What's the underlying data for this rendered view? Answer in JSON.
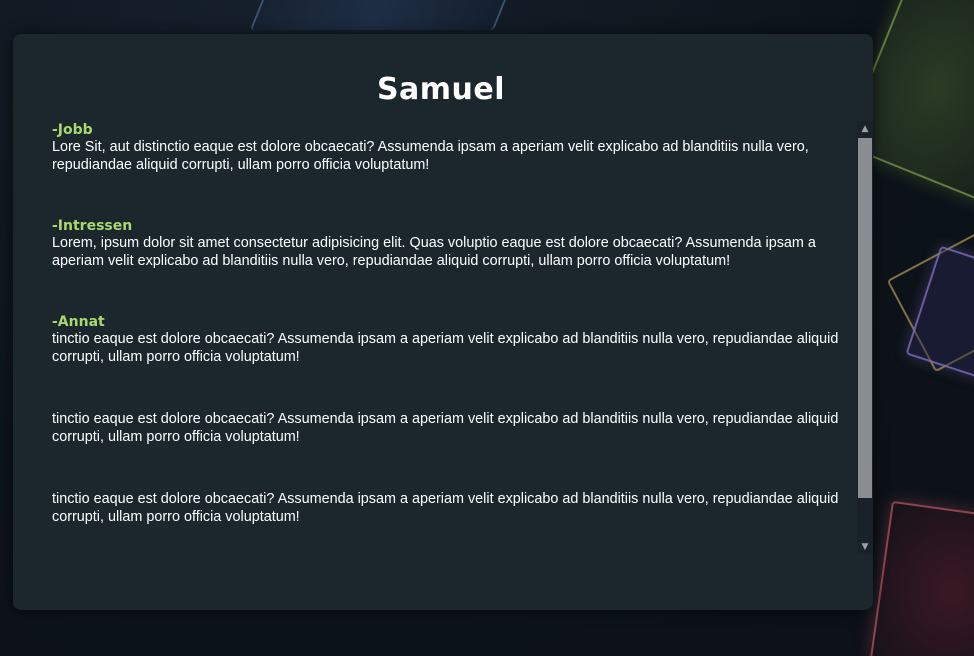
{
  "profile": {
    "name": "Samuel"
  },
  "sections": [
    {
      "heading": "-Jobb",
      "text": "Lore Sit, aut distinctio eaque est dolore obcaecati? Assumenda ipsam a aperiam velit explicabo ad blanditiis nulla vero, repudiandae aliquid corrupti, ullam porro officia voluptatum!"
    },
    {
      "heading": "-Intressen",
      "text": "Lorem, ipsum dolor sit amet consectetur adipisicing elit. Quas voluptio eaque est dolore obcaecati? Assumenda ipsam a aperiam velit explicabo ad blanditiis nulla vero, repudiandae aliquid corrupti, ullam porro officia voluptatum!"
    },
    {
      "heading": "-Annat",
      "text": "tinctio eaque est dolore obcaecati? Assumenda ipsam a aperiam velit explicabo ad blanditiis nulla vero, repudiandae aliquid corrupti, ullam porro officia voluptatum!"
    }
  ],
  "extra_paragraphs": [
    "tinctio eaque est dolore obcaecati? Assumenda ipsam a aperiam velit explicabo ad blanditiis nulla vero, repudiandae aliquid corrupti, ullam porro officia voluptatum!",
    "tinctio eaque est dolore obcaecati? Assumenda ipsam a aperiam velit explicabo ad blanditiis nulla vero, repudiandae aliquid corrupti, ullam porro officia voluptatum!"
  ],
  "scrollbar": {
    "up_icon": "chevron-up-icon",
    "down_icon": "chevron-down-icon",
    "up_glyph": "▲",
    "down_glyph": "▼"
  },
  "colors": {
    "heading_accent": "#a9d86e",
    "card_background": "#1c262d",
    "text": "#ffffff"
  }
}
